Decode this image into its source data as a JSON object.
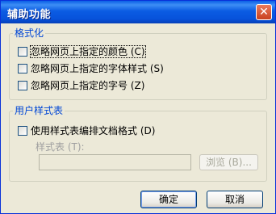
{
  "window": {
    "title": "辅助功能",
    "close_glyph": "✕"
  },
  "format_group": {
    "legend": "格式化",
    "options": [
      {
        "label": "忽略网页上指定的颜色 (C)",
        "checked": false
      },
      {
        "label": "忽略网页上指定的字体样式 (S)",
        "checked": false
      },
      {
        "label": "忽略网页上指定的字号 (Z)",
        "checked": false
      }
    ]
  },
  "stylesheet_group": {
    "legend": "用户样式表",
    "option": {
      "label": "使用样式表编排文档格式 (D)",
      "checked": false
    },
    "field_label": "样式表 (T):",
    "field_value": "",
    "browse_label": "浏览 (B)..."
  },
  "buttons": {
    "ok": "确定",
    "cancel": "取消"
  },
  "colors": {
    "titlebar": "#0a5fe6",
    "dialog_bg": "#ece9d8",
    "legend_text": "#0046d5"
  }
}
